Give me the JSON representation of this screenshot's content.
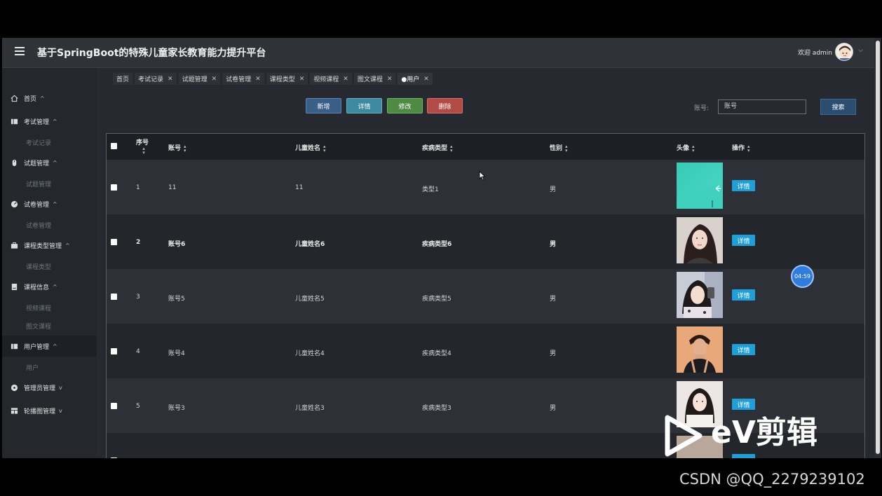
{
  "header": {
    "title": "基于SpringBoot的特殊儿童家长教育能力提升平台",
    "welcome": "欢迎 admin"
  },
  "sidebar": {
    "items": [
      {
        "label": "首页",
        "chev": "^"
      },
      {
        "label": "考试管理",
        "chev": "^",
        "sub": "考试记录"
      },
      {
        "label": "试题管理",
        "chev": "^",
        "sub": "试题管理"
      },
      {
        "label": "试卷管理",
        "chev": "^",
        "sub": "试卷管理"
      },
      {
        "label": "课程类型管理",
        "chev": "^",
        "sub": "课程类型"
      },
      {
        "label": "课程信息",
        "chev": "^",
        "sub": "视频课程",
        "sub2": "图文课程"
      },
      {
        "label": "用户管理",
        "chev": "^",
        "sub": "用户"
      },
      {
        "label": "管理员管理",
        "chev": "v"
      },
      {
        "label": "轮播图管理",
        "chev": "v"
      }
    ]
  },
  "tabs": [
    "首页",
    "考试记录",
    "试题管理",
    "试卷管理",
    "课程类型",
    "视频课程",
    "图文课程",
    "●用户"
  ],
  "toolbar": {
    "add": "新增",
    "detail": "详情",
    "edit": "修改",
    "delete": "删除",
    "search_label": "账号:",
    "search_placeholder": "账号",
    "search_button": "搜索"
  },
  "table": {
    "headers": [
      "序号",
      "账号",
      "儿童姓名",
      "疾病类型",
      "性别",
      "头像",
      "操作"
    ],
    "rows": [
      {
        "no": "1",
        "account": "11",
        "child": "11",
        "disease": "类型1",
        "gender": "男",
        "action": "详情"
      },
      {
        "no": "2",
        "account": "账号6",
        "child": "儿童姓名6",
        "disease": "疾病类型6",
        "gender": "男",
        "action": "详情"
      },
      {
        "no": "3",
        "account": "账号5",
        "child": "儿童姓名5",
        "disease": "疾病类型5",
        "gender": "男",
        "action": "详情"
      },
      {
        "no": "4",
        "account": "账号4",
        "child": "儿童姓名4",
        "disease": "疾病类型4",
        "gender": "男",
        "action": "详情"
      },
      {
        "no": "5",
        "account": "账号3",
        "child": "儿童姓名3",
        "disease": "疾病类型3",
        "gender": "男",
        "action": "详情"
      }
    ]
  },
  "overlay": {
    "timer": "04:59",
    "ev_text": "eV剪辑",
    "csdn": "CSDN @QQ_2279239102"
  },
  "colors": {
    "add": "#3a5f86",
    "detail": "#3d8aa0",
    "edit": "#4f8a44",
    "delete": "#b24a46",
    "action": "#1e9fd7"
  }
}
